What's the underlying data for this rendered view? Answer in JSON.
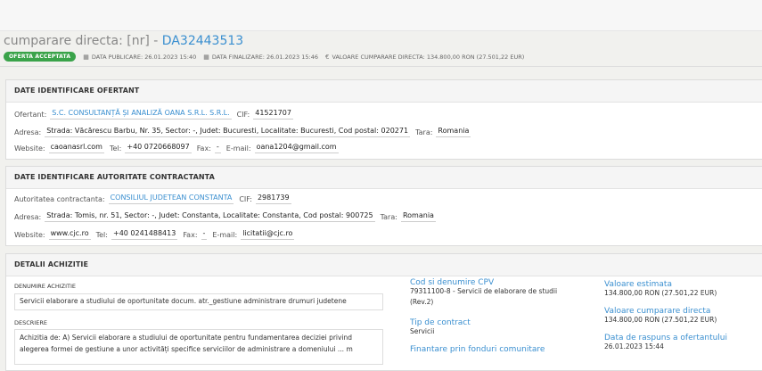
{
  "header": {
    "title_prefix": "cumparare directa: [nr] - ",
    "title_code": "DA32443513",
    "badge": "OFERTA ACCEPTATA",
    "data_publicare": "DATA PUBLICARE: 26.01.2023 15:40",
    "data_finalizare": "DATA FINALIZARE: 26.01.2023 15:46",
    "valoare": "VALOARE CUMPARARE DIRECTA: 134.800,00  RON (27.501,22  EUR)"
  },
  "ofertant": {
    "title": "DATE IDENTIFICARE OFERTANT",
    "ofertant_label": "Ofertant:",
    "ofertant_value": "S.C. CONSULTANȚĂ ȘI ANALIZĂ OANA S.R.L. S.R.L.",
    "cif_label": "CIF:",
    "cif_value": "41521707",
    "adresa_label": "Adresa:",
    "adresa_value": "Strada: Văcărescu Barbu, Nr. 35, Sector: -, Judet: Bucuresti, Localitate: Bucuresti, Cod postal: 020271",
    "tara_label": "Tara:",
    "tara_value": "Romania",
    "website_label": "Website:",
    "website_value": "caoanasrl.com",
    "tel_label": "Tel:",
    "tel_value": "+40 0720668097",
    "fax_label": "Fax:",
    "fax_value": "-",
    "email_label": "E-mail:",
    "email_value": "oana1204@gmail.com"
  },
  "autoritate": {
    "title": "DATE IDENTIFICARE AUTORITATE CONTRACTANTA",
    "autoritate_label": "Autoritatea contractanta:",
    "autoritate_value": "CONSILIUL JUDETEAN CONSTANTA",
    "cif_label": "CIF:",
    "cif_value": "2981739",
    "adresa_label": "Adresa:",
    "adresa_value": "Strada: Tomis, nr. 51, Sector: -, Judet: Constanta, Localitate: Constanta, Cod postal: 900725",
    "tara_label": "Tara:",
    "tara_value": "Romania",
    "website_label": "Website:",
    "website_value": "www.cjc.ro",
    "tel_label": "Tel:",
    "tel_value": "+40 0241488413",
    "fax_label": "Fax:",
    "fax_value": "-",
    "email_label": "E-mail:",
    "email_value": "licitatii@cjc.ro"
  },
  "detalii": {
    "title": "DETALII ACHIZITIE",
    "denumire_label": "DENUMIRE ACHIZITIE",
    "denumire_value": "Servicii elaborare a studiului de oportunitate docum. atr._gestiune administrare drumuri judetene",
    "descriere_label": "DESCRIERE",
    "descriere_line1": "Achizitia de: A) Servicii elaborare a studiului de oportunitate pentru fundamentarea deciziei privind",
    "descriere_line2": "alegerea formei de gestiune a unor activități specifice serviciilor de administrare a domeniului ... m",
    "cpv_label": "Cod si denumire CPV",
    "cpv_value_1": "79311100-8 - Servicii de elaborare de studii",
    "cpv_value_2": "(Rev.2)",
    "tip_label": "Tip de contract",
    "tip_value": "Servicii",
    "fonduri_label": "Finantare prin fonduri comunitare",
    "val_est_label": "Valoare estimata",
    "val_est_value": "134.800,00  RON (27.501,22  EUR)",
    "val_cump_label": "Valoare cumparare directa",
    "val_cump_value": "134.800,00  RON (27.501,22  EUR)",
    "data_rasp_label": "Data de raspuns a ofertantului",
    "data_rasp_value": "26.01.2023 15:44"
  }
}
